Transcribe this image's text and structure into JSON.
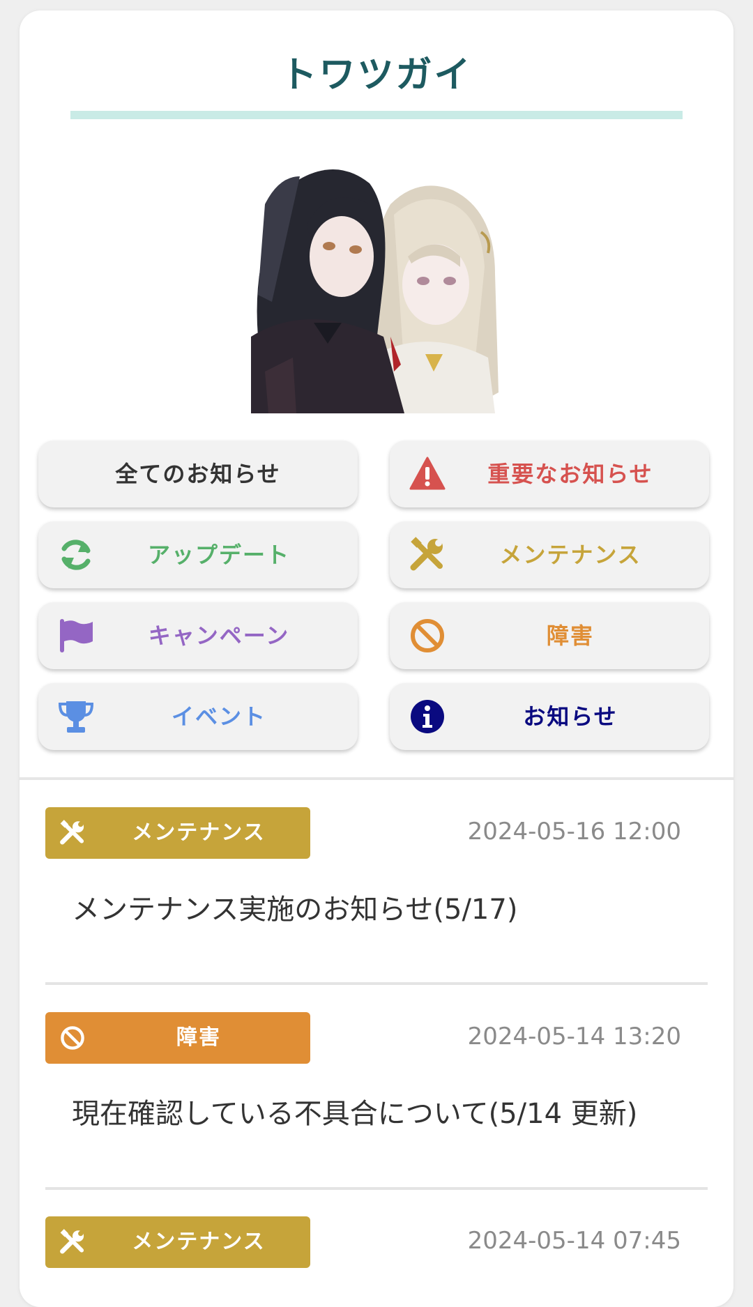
{
  "page": {
    "title": "トワツガイ"
  },
  "colors": {
    "title": "#1d5a60",
    "accent_bar": "#c9ebe6",
    "important": "#d6524f",
    "update": "#56b06a",
    "maintenance": "#c6a43a",
    "campaign": "#9466c4",
    "failure": "#e08e35",
    "event": "#5b8fe3",
    "info": "#0a0a80"
  },
  "categories": [
    {
      "id": "all",
      "label": "全てのお知らせ",
      "icon": ""
    },
    {
      "id": "important",
      "label": "重要なお知らせ",
      "icon": "warning-icon"
    },
    {
      "id": "update",
      "label": "アップデート",
      "icon": "refresh-icon"
    },
    {
      "id": "maintenance",
      "label": "メンテナンス",
      "icon": "tools-icon"
    },
    {
      "id": "campaign",
      "label": "キャンペーン",
      "icon": "flag-icon"
    },
    {
      "id": "failure",
      "label": "障害",
      "icon": "ban-icon"
    },
    {
      "id": "event",
      "label": "イベント",
      "icon": "trophy-icon"
    },
    {
      "id": "info",
      "label": "お知らせ",
      "icon": "info-icon"
    }
  ],
  "news": [
    {
      "category": "メンテナンス",
      "icon": "tools-icon",
      "date": "2024-05-16 12:00",
      "title": "メンテナンス実施のお知らせ(5/17)"
    },
    {
      "category": "障害",
      "icon": "ban-icon",
      "date": "2024-05-14 13:20",
      "title": "現在確認している不具合について(5/14 更新)"
    },
    {
      "category": "メンテナンス",
      "icon": "tools-icon",
      "date": "2024-05-14 07:45",
      "title": ""
    }
  ]
}
